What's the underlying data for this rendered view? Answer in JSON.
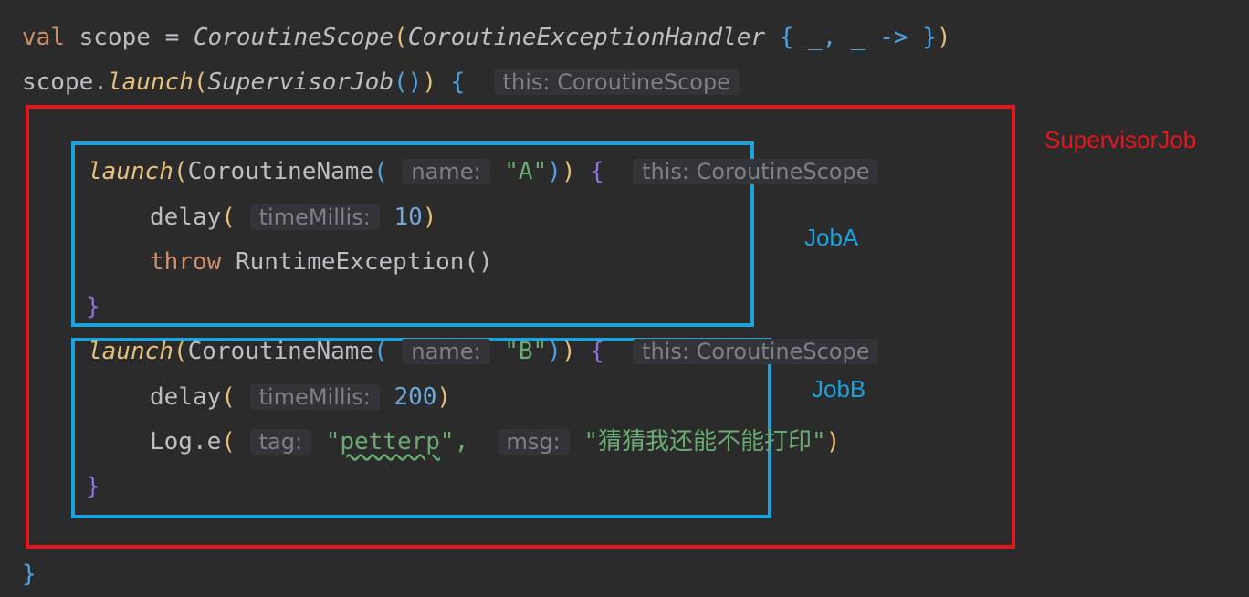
{
  "code": {
    "line1": {
      "kw_val": "val",
      "var": "scope",
      "eq": "=",
      "class_name": "CoroutineScope",
      "handler": "CoroutineExceptionHandler",
      "lambda": "_, _ ->"
    },
    "line2": {
      "receiver": "scope.",
      "call": "launch",
      "arg": "SupervisorJob",
      "hint": "this: CoroutineScope"
    },
    "jobA": {
      "call": "launch",
      "ctx": "CoroutineName",
      "param_hint": "name:",
      "param_value": "\"A\"",
      "scope_hint": "this: CoroutineScope",
      "delay_fn": "delay",
      "delay_hint": "timeMillis:",
      "delay_value": "10",
      "kw_throw": "throw",
      "exception": "RuntimeException()",
      "close": "}"
    },
    "jobB": {
      "call": "launch",
      "ctx": "CoroutineName",
      "param_hint": "name:",
      "param_value": "\"B\"",
      "scope_hint": "this: CoroutineScope",
      "delay_fn": "delay",
      "delay_hint": "timeMillis:",
      "delay_value": "200",
      "log_fn": "Log.e",
      "tag_hint": "tag:",
      "tag_open": "\"",
      "tag_value": "petterp",
      "tag_close": "\",",
      "msg_hint": "msg:",
      "msg_value": "\"猜猜我还能不能打印\"",
      "close": "}"
    },
    "final_close": "}"
  },
  "labels": {
    "supervisor": "SupervisorJob",
    "jobA": "JobA",
    "jobB": "JobB"
  },
  "colors": {
    "background": "#2b2b2b",
    "supervisor_box": "#e5161e",
    "job_box": "#1aa3dc",
    "keyword": "#cf8e6d",
    "string": "#6aab73",
    "number": "#6fa8dc"
  }
}
